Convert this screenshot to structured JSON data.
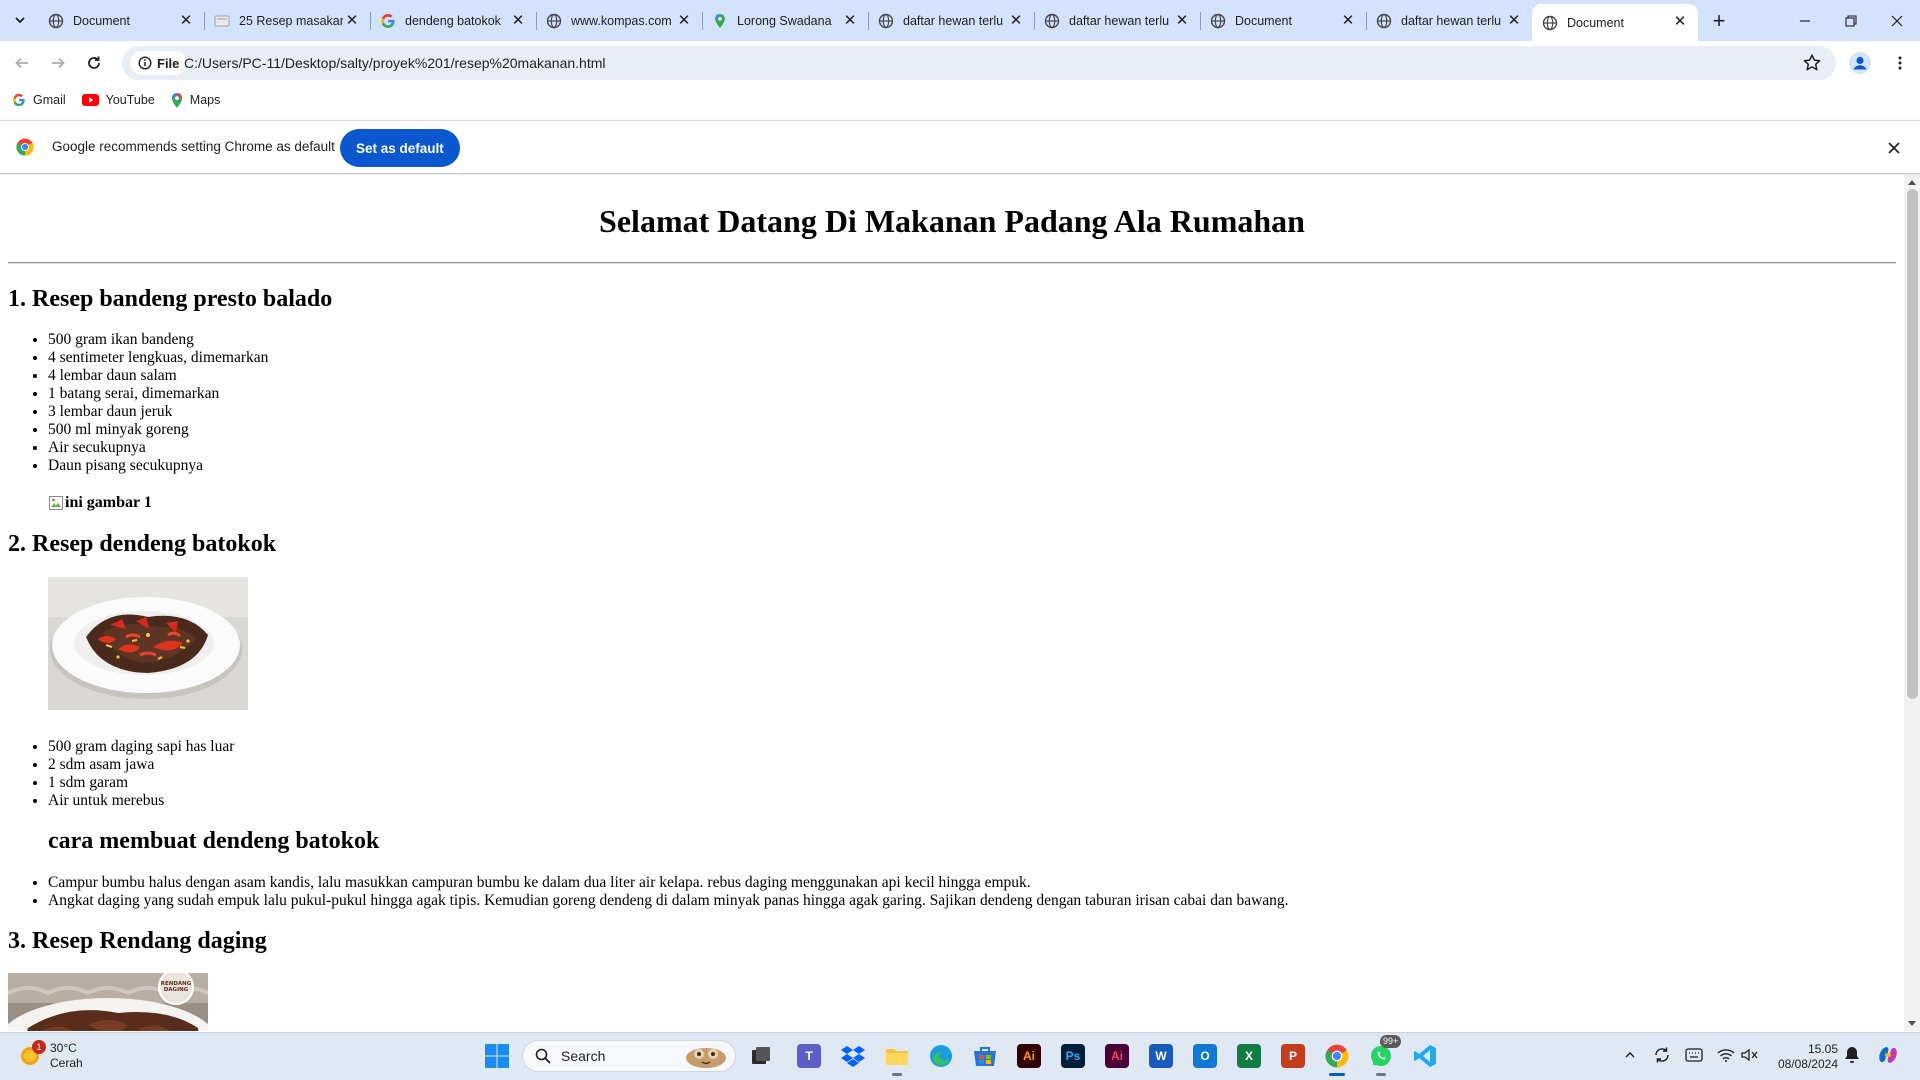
{
  "browser": {
    "tabs": [
      {
        "title": "Document",
        "favicon": "globe-icon"
      },
      {
        "title": "25 Resep masakan",
        "favicon": "page-icon"
      },
      {
        "title": "dendeng batokok",
        "favicon": "google-icon"
      },
      {
        "title": "www.kompas.com",
        "favicon": "globe-icon"
      },
      {
        "title": "Lorong Swadana",
        "favicon": "maps-pin-icon"
      },
      {
        "title": "daftar hewan terlu",
        "favicon": "globe-icon"
      },
      {
        "title": "daftar hewan terlu",
        "favicon": "globe-icon"
      },
      {
        "title": "Document",
        "favicon": "globe-icon"
      },
      {
        "title": "daftar hewan terlu",
        "favicon": "globe-icon"
      },
      {
        "title": "Document",
        "favicon": "globe-icon",
        "active": true
      }
    ],
    "omnibox": {
      "chip_label": "File",
      "url": "C:/Users/PC-11/Desktop/salty/proyek%201/resep%20makanan.html"
    },
    "bookmarks": [
      {
        "label": "Gmail",
        "icon": "google-icon"
      },
      {
        "label": "YouTube",
        "icon": "youtube-icon"
      },
      {
        "label": "Maps",
        "icon": "maps-pin-icon"
      }
    ],
    "infobar": {
      "message": "Google recommends setting Chrome as default",
      "button_label": "Set as default"
    },
    "colors": {
      "tabstrip": "#d3e3fd",
      "accent": "#0b57d0",
      "omnibox": "#e9eef6"
    }
  },
  "page": {
    "heading": "Selamat Datang Di Makanan Padang Ala Rumahan",
    "recipes": [
      {
        "title": "1. Resep bandeng presto balado",
        "ingredients": [
          "500 gram ikan bandeng",
          "4 sentimeter lengkuas, dimemarkan",
          "4 lembar daun salam",
          "1 batang serai, dimemarkan",
          "3 lembar daun jeruk",
          "500 ml minyak goreng",
          "Air secukupnya",
          "Daun pisang secukupnya"
        ],
        "image_alt": "ini gambar 1"
      },
      {
        "title": "2. Resep dendeng batokok",
        "image_alt": "dendeng batokok",
        "ingredients": [
          "500 gram daging sapi has luar",
          "2 sdm asam jawa",
          "1 sdm garam",
          "Air untuk merebus"
        ],
        "method_title": "cara membuat dendeng batokok",
        "steps": [
          "Campur bumbu halus dengan asam kandis, lalu masukkan campuran bumbu ke dalam dua liter air kelapa. rebus daging menggunakan api kecil hingga empuk.",
          "Angkat daging yang sudah empuk lalu pukul-pukul hingga agak tipis. Kemudian goreng dendeng di dalam minyak panas hingga agak garing. Sajikan dendeng dengan taburan irisan cabai dan bawang."
        ]
      },
      {
        "title": "3. Resep Rendang daging",
        "image_label": "RENDANG DAGING"
      }
    ]
  },
  "taskbar": {
    "weather": {
      "temp": "30°C",
      "condition": "Cerah",
      "badge": "1"
    },
    "search_placeholder": "Search",
    "whatsapp_badge": "99+",
    "clock": {
      "time": "15.05",
      "date": "08/08/2024"
    },
    "apps": [
      "windows-start-icon",
      "search-icon",
      "task-view-icon",
      "teams-icon",
      "dropbox-icon",
      "file-explorer-icon",
      "edge-icon",
      "store-icon",
      "illustrator-icon",
      "photoshop-icon",
      "illustrator-alt-icon",
      "word-icon",
      "outlook-icon",
      "excel-icon",
      "powerpoint-icon",
      "chrome-icon",
      "whatsapp-icon",
      "vscode-icon"
    ]
  }
}
